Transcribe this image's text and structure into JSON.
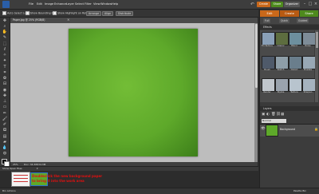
{
  "menubar": {
    "items": [
      "File",
      "Edit",
      "Image",
      "Enhance",
      "Layer",
      "Select",
      "Filter",
      "View",
      "Window",
      "Help"
    ],
    "create_label": "Create",
    "share_label": "Share",
    "organizer_label": "Organizer",
    "colors": {
      "create": "#c9681a",
      "share": "#4e8a1d"
    }
  },
  "options": {
    "auto_select_label": "Auto Select Layer",
    "show_bbox_label": "Show Bounding Box",
    "show_highlight_label": "Show Highlight on Rollover",
    "arrange_label": "Arrange",
    "align_label": "Align",
    "distribute_label": "Distribute"
  },
  "document": {
    "tab_title": "Paper.jpg @ 25% (RGB/8)",
    "zoom": "25%",
    "info": "Doc: 34.3M/34.3M"
  },
  "bin": {
    "tab_label": "Show Open Files",
    "bin_actions_label": "Bin Actions",
    "annotation_line1": "Doubleclick the new background paper",
    "annotation_line2": "to bring it into the work area",
    "palette_bin_label": "Palette Bin"
  },
  "rightpanel": {
    "modes": [
      "Edit",
      "Create",
      "Share"
    ],
    "subtabs": [
      "Full",
      "Quick",
      "Guided"
    ],
    "effects_title": "Effects",
    "effects": [
      {
        "label": "Fill Texture",
        "color": "#8aa0b8"
      },
      {
        "label": "Interior",
        "color": "#5d6d3f"
      },
      {
        "label": "Blend",
        "color": "#6d8f9e"
      },
      {
        "label": "Noise",
        "color": "#7e8c98"
      },
      {
        "label": "Brush",
        "color": "#4f5a6a"
      },
      {
        "label": "Sketch",
        "color": "#8e9ea8"
      },
      {
        "label": "Distort",
        "color": "#6a7e8c"
      },
      {
        "label": "Pixelate",
        "color": "#98a8b5"
      },
      {
        "label": "Render",
        "color": "#c0c6cc"
      },
      {
        "label": "Stylize",
        "color": "#9aa3ad"
      },
      {
        "label": "Texture",
        "color": "#b8c4ce"
      },
      {
        "label": "Sharpen",
        "color": "#a5b3bf"
      }
    ],
    "layers_title": "Layers",
    "blend_mode": "Normal",
    "layer_name": "Background"
  },
  "tools": [
    "move",
    "zoom",
    "hand",
    "eyedropper",
    "marquee",
    "lasso",
    "magic-wand",
    "quick-select",
    "type",
    "crop",
    "cookie-cutter",
    "straighten",
    "red-eye",
    "healing",
    "clone",
    "eraser",
    "pencil",
    "brush",
    "smart-brush",
    "paint-bucket",
    "gradient",
    "shape",
    "blur",
    "sponge",
    "foreground-color",
    "background-color"
  ]
}
